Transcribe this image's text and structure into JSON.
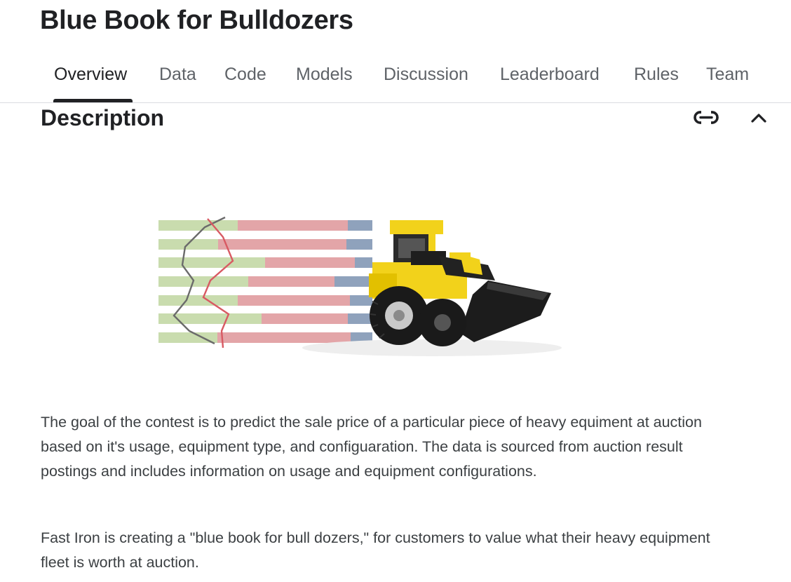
{
  "header": {
    "title": "Blue Book for Bulldozers"
  },
  "tabs": [
    {
      "label": "Overview",
      "active": true
    },
    {
      "label": "Data"
    },
    {
      "label": "Code"
    },
    {
      "label": "Models"
    },
    {
      "label": "Discussion"
    },
    {
      "label": "Leaderboard"
    },
    {
      "label": "Rules"
    },
    {
      "label": "Team"
    }
  ],
  "section": {
    "title": "Description",
    "icons": {
      "link": "link-icon",
      "collapse": "chevron-up-icon"
    }
  },
  "hero_image": {
    "icon": "bulldozer-chart-illustration"
  },
  "body": {
    "paragraphs": [
      "The goal of the contest is to predict the sale price of a particular piece of heavy equiment at auction based on it's usage, equipment type, and configuaration.  The data is sourced from auction result postings and includes information on usage and equipment configurations.",
      "Fast Iron is creating a \"blue book for bull dozers,\" for customers to value what their heavy equipment fleet is worth at auction."
    ]
  },
  "colors": {
    "text": "#202124",
    "muted": "#5f6368",
    "divider": "#dadce0",
    "bar_green": "#c9dcae",
    "bar_red": "#e3a5a8",
    "bar_blue": "#8fa2bc",
    "dozer_yellow": "#f2d21b"
  }
}
